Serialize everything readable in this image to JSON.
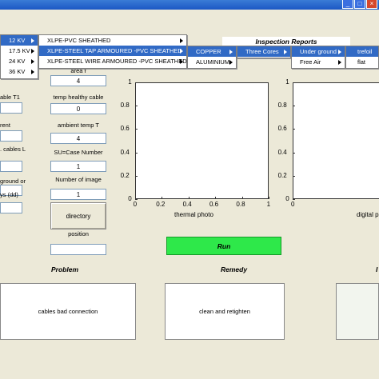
{
  "window": {
    "minimize": "_",
    "maximize": "□",
    "close": "×"
  },
  "menus": {
    "voltage": [
      {
        "label": "12 KV"
      },
      {
        "label": "17.5 KV"
      },
      {
        "label": "24 KV"
      },
      {
        "label": "36 KV"
      }
    ],
    "cable_type": [
      {
        "label": "XLPE-PVC SHEATHED"
      },
      {
        "label": "XLPE-STEEL TAP ARMOURED -PVC SHEATHED"
      },
      {
        "label": "XLPE-STEEL WIRE ARMOURED -PVC SHEATHED"
      }
    ],
    "conductor": [
      {
        "label": "COPPER"
      },
      {
        "label": "ALUMINIUM"
      }
    ],
    "cores": [
      {
        "label": "Three Cores"
      }
    ],
    "install": [
      {
        "label": "Under ground"
      },
      {
        "label": "Free Air"
      }
    ],
    "arrangement": [
      {
        "label": "trefoil"
      },
      {
        "label": "flat"
      }
    ]
  },
  "header": {
    "inspection_reports": "Inspection Reports"
  },
  "left_labels": {
    "cable_t1": "able T1",
    "current": "rent",
    "cables_l": ". cables L",
    "ground": "ground or",
    "days": "ys (dd)"
  },
  "form": {
    "area_label": "area f",
    "area_value": "4",
    "temp_healthy_label": "temp healthy cable",
    "temp_healthy_value": "0",
    "ambient_label": "ambient temp T",
    "ambient_value": "4",
    "su_label": "SU=Case Number",
    "su_value": "1",
    "num_image_label": "Number of image",
    "num_image_value": "1",
    "directory_button": "directory",
    "position_label": "position"
  },
  "plots": {
    "thermal_xlabel": "thermal photo",
    "digital_xlabel": "digital p",
    "ticks": [
      "0",
      "0.2",
      "0.4",
      "0.6",
      "0.8",
      "1"
    ]
  },
  "run_button": "Run",
  "sections": {
    "problem_title": "Problem",
    "problem_text": "cables bad connection",
    "remedy_title": "Remedy",
    "remedy_text": "clean and retighten",
    "third_title": "I"
  }
}
